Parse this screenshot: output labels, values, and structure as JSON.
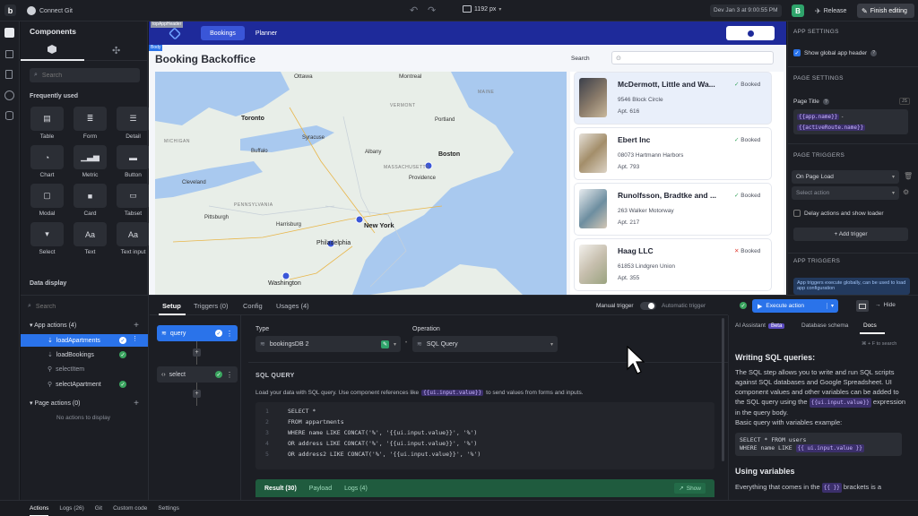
{
  "topbar": {
    "repo_label": "Connect Git",
    "width_label": "1192 px",
    "timestamp": "Dev Jan 3 at 9:00:55 PM",
    "release_label": "Release",
    "finish_label": "Finish editing"
  },
  "components": {
    "title": "Components",
    "search_placeholder": "Search",
    "frequently_used": "Frequently used",
    "items": [
      {
        "label": "Table",
        "icon": "table-icon"
      },
      {
        "label": "Form",
        "icon": "form-icon"
      },
      {
        "label": "Detail",
        "icon": "detail-icon"
      },
      {
        "label": "Chart",
        "icon": "chart-icon"
      },
      {
        "label": "Metric",
        "icon": "metric-icon"
      },
      {
        "label": "Button",
        "icon": "button-icon"
      },
      {
        "label": "Modal",
        "icon": "modal-icon"
      },
      {
        "label": "Card",
        "icon": "card-icon"
      },
      {
        "label": "Tabset",
        "icon": "tabset-icon"
      },
      {
        "label": "Select",
        "icon": "select-icon"
      },
      {
        "label": "Text",
        "icon": "text-icon"
      },
      {
        "label": "Text input",
        "icon": "text-input-icon"
      }
    ],
    "data_display": "Data display"
  },
  "app": {
    "header_tag": "topAppHeader",
    "nav": [
      "Bookings",
      "Planner"
    ],
    "body_tag": "Body",
    "title": "Booking Backoffice",
    "search_label": "Search",
    "map_cities": [
      "Ottawa",
      "Montreal",
      "Toronto",
      "Portland",
      "Buffalo",
      "Syracuse",
      "Albany",
      "Boston",
      "Cleveland",
      "Providence",
      "Harrisburg",
      "Pittsburgh",
      "New York",
      "Philadelphia",
      "Washington",
      "MASSACHUSETTS",
      "PENNSYLVANIA",
      "MICHIGAN",
      "VERMONT",
      "MAINE"
    ]
  },
  "bookings": [
    {
      "name": "McDermott, Little and Wa...",
      "address": "9546 Block Circle",
      "apt": "Apt. 616",
      "status": "Booked",
      "status_color": "#3aa55f",
      "ok": true
    },
    {
      "name": "Ebert Inc",
      "address": "08073 Hartmann Harbors",
      "apt": "Apt. 793",
      "status": "Booked",
      "status_color": "#3aa55f",
      "ok": true
    },
    {
      "name": "Runolfsson, Bradtke and ...",
      "address": "263 Walker Motorway",
      "apt": "Apt. 217",
      "status": "Booked",
      "status_color": "#3aa55f",
      "ok": true
    },
    {
      "name": "Haag LLC",
      "address": "61853 Lindgren Union",
      "apt": "Apt. 355",
      "status": "Booked",
      "status_color": "#e0443a",
      "ok": false
    }
  ],
  "right_panel": {
    "app_settings": "APP SETTINGS",
    "show_header": "Show global app header",
    "page_settings": "PAGE SETTINGS",
    "page_title": "Page Title",
    "page_title_badge": "JS",
    "page_title_expr1": "{{app.name}}",
    "page_title_dash": "-",
    "page_title_expr2": "{{activeRoute.name}}",
    "page_triggers": "PAGE TRIGGERS",
    "on_page_load": "On Page Load",
    "select_action": "Select action",
    "delay_label": "Delay actions and show loader",
    "add_trigger": "+ Add trigger",
    "app_triggers": "APP TRIGGERS",
    "app_triggers_note": "App triggers execute globally, can be used to load app configuration"
  },
  "actions": {
    "search_placeholder": "Search",
    "app_actions": "App actions (4)",
    "items": [
      "loadApartments",
      "loadBookings",
      "selectItem",
      "selectApartment"
    ],
    "page_actions": "Page actions (0)",
    "no_actions": "No actions to display"
  },
  "editor": {
    "tabs": [
      "Setup",
      "Triggers (0)",
      "Config",
      "Usages (4)"
    ],
    "manual_trigger": "Manual trigger",
    "automatic_trigger": "Automatic trigger",
    "execute": "Execute action",
    "hide": "Hide",
    "steps": [
      {
        "label": "query"
      },
      {
        "label": "select"
      }
    ],
    "type_label": "Type",
    "type_value": "bookingsDB 2",
    "operation_label": "Operation",
    "operation_value": "SQL Query",
    "sql_heading": "SQL QUERY",
    "sql_help_pre": "Load your data with SQL query. Use component references like",
    "sql_help_pill": "{{ui.input.value}}",
    "sql_help_post": "to send values from forms and inputs.",
    "code": [
      "SELECT *",
      "FROM appartments",
      "WHERE name LIKE CONCAT('%', '{{ui.input.value}}', '%')",
      "OR address LIKE CONCAT('%', '{{ui.input.value}}', '%')",
      "OR address2 LIKE CONCAT('%', '{{ui.input.value}}', '%')"
    ],
    "line_numbers": [
      "1",
      "2",
      "3",
      "4",
      "5"
    ],
    "result_tabs": [
      "Result (30)",
      "Payload",
      "Logs (4)"
    ],
    "show": "Show"
  },
  "docs": {
    "tabs": [
      "AI Assistant",
      "Database schema",
      "Docs"
    ],
    "beta": "Beta",
    "shortcut": "⌘ + F to search",
    "heading1": "Writing SQL queries:",
    "p1": "The SQL step allows you to write and run SQL scripts against SQL databases and Google Spreadsheet. UI component values and other variables can be added to the SQL query using the",
    "p1_pill": "{{ui.input.value}}",
    "p1_post": "expression in the query body.",
    "p2": "Basic query with variables example:",
    "example1": "SELECT * FROM users",
    "example2_pre": "WHERE name LIKE",
    "example2_pill": "{{ ui.input.value }}",
    "heading2": "Using variables",
    "p3_pre": "Everything that comes in the",
    "p3_pill": "{{ }}",
    "p3_post": "brackets is a"
  },
  "status_tabs": [
    "Actions",
    "Logs (26)",
    "Git",
    "Custom code",
    "Settings"
  ],
  "colors": {
    "accent": "#2a73ea",
    "brand_nav": "#1e2a9a",
    "success": "#3aa55f",
    "purple": "#8a5cf6"
  }
}
